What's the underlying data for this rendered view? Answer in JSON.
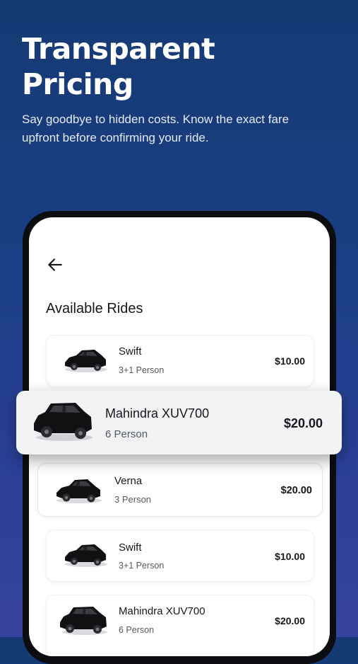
{
  "hero": {
    "title": "Transparent Pricing",
    "subtitle": "Say goodbye to hidden costs. Know the exact fare upfront before confirming your ride."
  },
  "screen": {
    "title": "Available Rides",
    "back_icon": "arrow-left-icon"
  },
  "rides": [
    {
      "name": "Swift",
      "seats": "3+1 Person",
      "price": "$10.00",
      "car_icon": "sedan-car-icon"
    },
    {
      "name": "Mahindra XUV700",
      "seats": "6 Person",
      "price": "$20.00",
      "car_icon": "suv-car-icon"
    },
    {
      "name": "Verna",
      "seats": "3 Person",
      "price": "$20.00",
      "car_icon": "sedan-car-icon"
    },
    {
      "name": "Swift",
      "seats": "3+1 Person",
      "price": "$10.00",
      "car_icon": "sedan-car-icon"
    },
    {
      "name": "Mahindra XUV700",
      "seats": "6 Person",
      "price": "$20.00",
      "car_icon": "suv-car-icon"
    }
  ],
  "colors": {
    "background_top": "#153a73",
    "background_bottom": "#36439f",
    "phone_frame": "#0c0d11",
    "car": "#111114"
  }
}
